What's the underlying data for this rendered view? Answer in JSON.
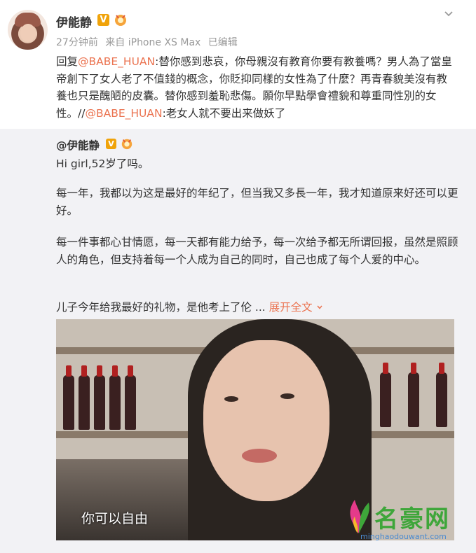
{
  "post": {
    "username": "伊能静",
    "verified_badge": "V",
    "meta": {
      "time": "27分钟前",
      "source": "来自 iPhone XS Max",
      "edited": "已编辑"
    },
    "reply": {
      "prefix": "回复",
      "mention1": "@BABE_HUAN",
      "text1": ":替你感到悲哀，你母親沒有教育你要有教養嗎？男人為了當皇帝創下了女人老了不值錢的概念，你貶抑同樣的女性為了什麼？再青春貌美沒有教養也只是醜陋的皮囊。替你感到羞恥悲傷。願你早點學會禮貌和尊重同性別的女性。//",
      "mention2": "@BABE_HUAN",
      "text2": ":老女人就不要出来做妖了"
    }
  },
  "quoted": {
    "username": "@伊能静",
    "verified_badge": "V",
    "p1": "Hi girl,52岁了吗。",
    "p2": "每一年，我都以为这是最好的年纪了，但当我又多長一年，我才知道原来好还可以更好。",
    "p3": "每一件事都心甘情愿，每一天都有能力给予，每一次给予都无所谓回报，虽然是照顾人的角色，但支持着每一个人成为自己的同时，自己也成了每个人爱的中心。",
    "p4": "儿子今年给我最好的礼物，是他考上了伦 ...",
    "expand": "展开全文",
    "photo_caption": "你可以自由"
  },
  "watermark": {
    "name": "名豪网",
    "url": "minghaodouwant.com"
  },
  "colors": {
    "link": "#eb7350",
    "quoted_bg": "#f2f2f5",
    "badge": "#f0a30a"
  },
  "icons": [
    "chevron-down-icon",
    "verified-icon",
    "medal-icon"
  ]
}
